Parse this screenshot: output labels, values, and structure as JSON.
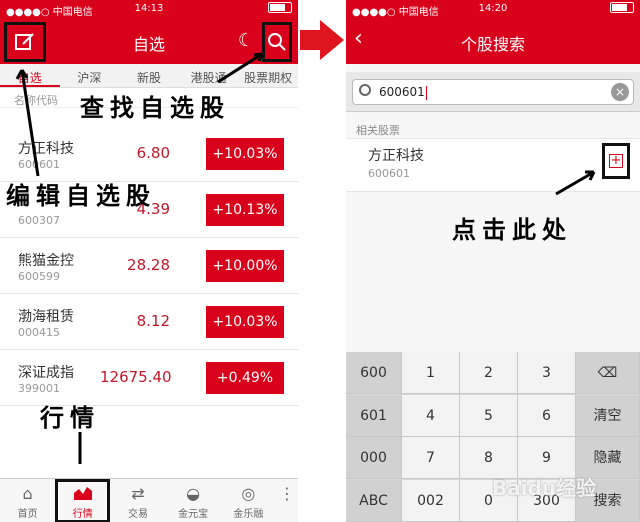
{
  "left": {
    "status": {
      "carrier": "●●●●○ 中国电信 ",
      "time": "14:13"
    },
    "nav": {
      "title": "自选"
    },
    "tabs": [
      "自选",
      "沪深",
      "新股",
      "港股通",
      "股票期权"
    ],
    "col_header": "名称代码",
    "rows": [
      {
        "name": "方正科技",
        "code": "600601",
        "price": "6.80",
        "change": "+10.03%"
      },
      {
        "name": "",
        "code": "600307",
        "price": "4.39",
        "change": "+10.13%"
      },
      {
        "name": "熊猫金控",
        "code": "600599",
        "price": "28.28",
        "change": "+10.00%"
      },
      {
        "name": "渤海租赁",
        "code": "000415",
        "price": "8.12",
        "change": "+10.03%"
      },
      {
        "name": "深证成指",
        "code": "399001",
        "price": "12675.40",
        "change": "+0.49%"
      }
    ],
    "tabbar": [
      {
        "label": "首页",
        "icon": "home-icon"
      },
      {
        "label": "行情",
        "icon": "chart-icon"
      },
      {
        "label": "交易",
        "icon": "trade-icon"
      },
      {
        "label": "金元宝",
        "icon": "ingot-icon"
      },
      {
        "label": "金乐融",
        "icon": "coin-icon"
      }
    ]
  },
  "right": {
    "status": {
      "carrier": "●●●●○ 中国电信 ",
      "time": "14:20"
    },
    "nav": {
      "title": "个股搜索"
    },
    "search": {
      "value": "600601"
    },
    "section": "相关股票",
    "result": {
      "name": "方正科技",
      "code": "600601",
      "add": "+"
    },
    "keys": [
      [
        "600",
        "1",
        "2",
        "3",
        "⌫"
      ],
      [
        "601",
        "4",
        "5",
        "6",
        "清空"
      ],
      [
        "000",
        "7",
        "8",
        "9",
        "隐藏"
      ],
      [
        "ABC",
        "002",
        "0",
        "300",
        "搜索"
      ]
    ]
  },
  "annotations": {
    "search": "查找自选股",
    "edit": "编辑自选股",
    "market": "行情",
    "click": "点击此处"
  },
  "watermark": "Baidu经验",
  "colors": {
    "brand_red": "#d9001b",
    "up_red": "#c0192b"
  }
}
